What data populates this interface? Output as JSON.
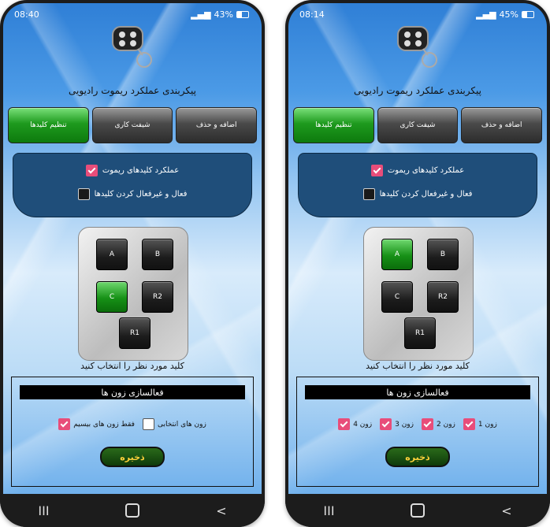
{
  "left": {
    "status": {
      "time": "08:40",
      "battery": "43%",
      "battery_level": 0.43
    },
    "title": "پیکربندی عملکرد ریموت رادیویی",
    "tabs": [
      "اضافه و حذف",
      "شیفت کاری",
      "تنظیم کلیدها"
    ],
    "active_tab": "تنظیم کلیدها",
    "panel": {
      "option1": {
        "label": "عملکرد کلیدهای ریموت",
        "checked": true
      },
      "option2": {
        "label": "فعال و غیرفعال کردن کلیدها",
        "checked": false
      }
    },
    "keys": [
      "A",
      "B",
      "C",
      "R2",
      "R1"
    ],
    "selected_key": "C",
    "pick_label": "کلید مورد نظر را انتخاب کنید",
    "zone_title": "فعالسازی زون ها",
    "zone_options": [
      {
        "label": "زون های انتخابی",
        "checked": false
      },
      {
        "label": "فقط زون های بیسیم",
        "checked": true
      }
    ],
    "save_label": "ذخیره"
  },
  "right": {
    "status": {
      "time": "08:14",
      "battery": "45%",
      "battery_level": 0.45
    },
    "title": "پیکربندی عملکرد ریموت رادیویی",
    "tabs": [
      "اضافه و حذف",
      "شیفت کاری",
      "تنظیم کلیدها"
    ],
    "active_tab": "تنظیم کلیدها",
    "panel": {
      "option1": {
        "label": "عملکرد کلیدهای ریموت",
        "checked": true
      },
      "option2": {
        "label": "فعال و غیرفعال کردن کلیدها",
        "checked": false
      }
    },
    "keys": [
      "A",
      "B",
      "C",
      "R2",
      "R1"
    ],
    "selected_key": "A",
    "pick_label": "کلید مورد نظر را انتخاب کنید",
    "zone_title": "فعالسازی زون ها",
    "zones": [
      {
        "label": "زون 1",
        "checked": true
      },
      {
        "label": "زون 2",
        "checked": true
      },
      {
        "label": "زون 3",
        "checked": true
      },
      {
        "label": "زون 4",
        "checked": true
      }
    ],
    "save_label": "ذخیره"
  },
  "navbar": {
    "back": "<",
    "recents": "III"
  },
  "colors": {
    "accent_green": "#169016",
    "checkbox_pink": "#e84d7a",
    "panel_blue": "#1f4e7a"
  }
}
